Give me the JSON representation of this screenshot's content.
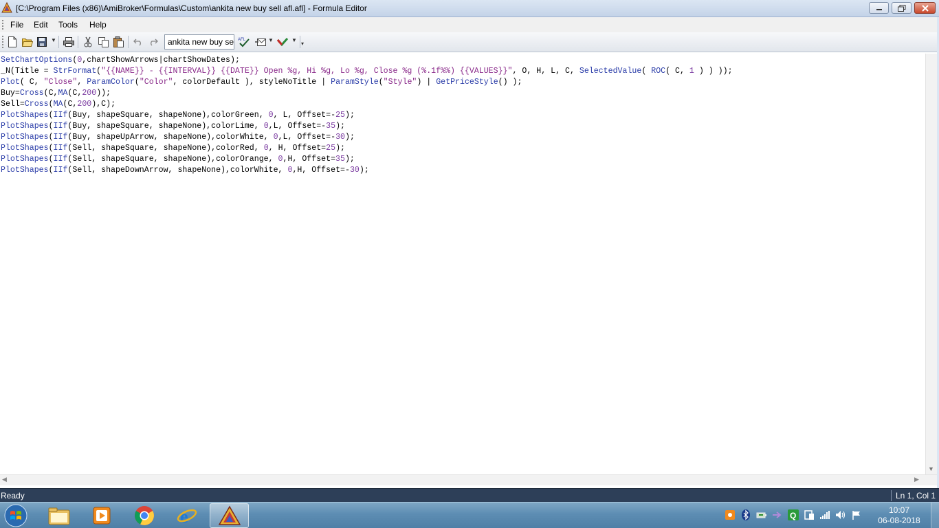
{
  "window": {
    "title": "[C:\\Program Files (x86)\\AmiBroker\\Formulas\\Custom\\ankita new buy sell afl.afl] - Formula Editor"
  },
  "menu": [
    "File",
    "Edit",
    "Tools",
    "Help"
  ],
  "toolbar": {
    "formula_name": "ankita new buy se"
  },
  "code_lines": [
    [
      {
        "t": "SetChartOptions",
        "c": "fn"
      },
      {
        "t": "(",
        "c": "plain"
      },
      {
        "t": "0",
        "c": "num"
      },
      {
        "t": ",chartShowArrows|chartShowDates);",
        "c": "plain"
      }
    ],
    [
      {
        "t": "_N(Title = ",
        "c": "plain"
      },
      {
        "t": "StrFormat",
        "c": "fn"
      },
      {
        "t": "(",
        "c": "plain"
      },
      {
        "t": "\"{{NAME}} - {{INTERVAL}} {{DATE}} Open %g, Hi %g, Lo %g, Close %g (%.1f%%) {{VALUES}}\"",
        "c": "str"
      },
      {
        "t": ", O, H, L, C, ",
        "c": "plain"
      },
      {
        "t": "SelectedValue",
        "c": "fn"
      },
      {
        "t": "( ",
        "c": "plain"
      },
      {
        "t": "ROC",
        "c": "fn"
      },
      {
        "t": "( C, ",
        "c": "plain"
      },
      {
        "t": "1",
        "c": "num"
      },
      {
        "t": " ) ) ));",
        "c": "plain"
      }
    ],
    [
      {
        "t": "Plot",
        "c": "fn"
      },
      {
        "t": "( C, ",
        "c": "plain"
      },
      {
        "t": "\"Close\"",
        "c": "str"
      },
      {
        "t": ", ",
        "c": "plain"
      },
      {
        "t": "ParamColor",
        "c": "fn"
      },
      {
        "t": "(",
        "c": "plain"
      },
      {
        "t": "\"Color\"",
        "c": "str"
      },
      {
        "t": ", colorDefault ), styleNoTitle | ",
        "c": "plain"
      },
      {
        "t": "ParamStyle",
        "c": "fn"
      },
      {
        "t": "(",
        "c": "plain"
      },
      {
        "t": "\"Style\"",
        "c": "str"
      },
      {
        "t": ") | ",
        "c": "plain"
      },
      {
        "t": "GetPriceStyle",
        "c": "fn"
      },
      {
        "t": "() );",
        "c": "plain"
      }
    ],
    [
      {
        "t": "Buy=",
        "c": "plain"
      },
      {
        "t": "Cross",
        "c": "fn"
      },
      {
        "t": "(C,",
        "c": "plain"
      },
      {
        "t": "MA",
        "c": "fn"
      },
      {
        "t": "(C,",
        "c": "plain"
      },
      {
        "t": "200",
        "c": "num"
      },
      {
        "t": "));",
        "c": "plain"
      }
    ],
    [
      {
        "t": "Sell=",
        "c": "plain"
      },
      {
        "t": "Cross",
        "c": "fn"
      },
      {
        "t": "(",
        "c": "plain"
      },
      {
        "t": "MA",
        "c": "fn"
      },
      {
        "t": "(C,",
        "c": "plain"
      },
      {
        "t": "200",
        "c": "num"
      },
      {
        "t": "),C);",
        "c": "plain"
      }
    ],
    [
      {
        "t": "PlotShapes",
        "c": "fn"
      },
      {
        "t": "(",
        "c": "plain"
      },
      {
        "t": "IIf",
        "c": "fn"
      },
      {
        "t": "(Buy, shapeSquare, shapeNone),colorGreen, ",
        "c": "plain"
      },
      {
        "t": "0",
        "c": "num"
      },
      {
        "t": ", L, Offset=-",
        "c": "plain"
      },
      {
        "t": "25",
        "c": "num"
      },
      {
        "t": ");",
        "c": "plain"
      }
    ],
    [
      {
        "t": "PlotShapes",
        "c": "fn"
      },
      {
        "t": "(",
        "c": "plain"
      },
      {
        "t": "IIf",
        "c": "fn"
      },
      {
        "t": "(Buy, shapeSquare, shapeNone),colorLime, ",
        "c": "plain"
      },
      {
        "t": "0",
        "c": "num"
      },
      {
        "t": ",L, Offset=-",
        "c": "plain"
      },
      {
        "t": "35",
        "c": "num"
      },
      {
        "t": ");",
        "c": "plain"
      }
    ],
    [
      {
        "t": "PlotShapes",
        "c": "fn"
      },
      {
        "t": "(",
        "c": "plain"
      },
      {
        "t": "IIf",
        "c": "fn"
      },
      {
        "t": "(Buy, shapeUpArrow, shapeNone),colorWhite, ",
        "c": "plain"
      },
      {
        "t": "0",
        "c": "num"
      },
      {
        "t": ",L, Offset=-",
        "c": "plain"
      },
      {
        "t": "30",
        "c": "num"
      },
      {
        "t": ");",
        "c": "plain"
      }
    ],
    [
      {
        "t": "PlotShapes",
        "c": "fn"
      },
      {
        "t": "(",
        "c": "plain"
      },
      {
        "t": "IIf",
        "c": "fn"
      },
      {
        "t": "(Sell, shapeSquare, shapeNone),colorRed, ",
        "c": "plain"
      },
      {
        "t": "0",
        "c": "num"
      },
      {
        "t": ", H, Offset=",
        "c": "plain"
      },
      {
        "t": "25",
        "c": "num"
      },
      {
        "t": ");",
        "c": "plain"
      }
    ],
    [
      {
        "t": "PlotShapes",
        "c": "fn"
      },
      {
        "t": "(",
        "c": "plain"
      },
      {
        "t": "IIf",
        "c": "fn"
      },
      {
        "t": "(Sell, shapeSquare, shapeNone),colorOrange, ",
        "c": "plain"
      },
      {
        "t": "0",
        "c": "num"
      },
      {
        "t": ",H, Offset=",
        "c": "plain"
      },
      {
        "t": "35",
        "c": "num"
      },
      {
        "t": ");",
        "c": "plain"
      }
    ],
    [
      {
        "t": "PlotShapes",
        "c": "fn"
      },
      {
        "t": "(",
        "c": "plain"
      },
      {
        "t": "IIf",
        "c": "fn"
      },
      {
        "t": "(Sell, shapeDownArrow, shapeNone),colorWhite, ",
        "c": "plain"
      },
      {
        "t": "0",
        "c": "num"
      },
      {
        "t": ",H, Offset=-",
        "c": "plain"
      },
      {
        "t": "30",
        "c": "num"
      },
      {
        "t": ");",
        "c": "plain"
      }
    ]
  ],
  "status": {
    "left": "Ready",
    "right": "Ln 1, Col 1"
  },
  "taskbar": {
    "apps": [
      "windows-explorer",
      "media-player",
      "chrome",
      "internet-explorer",
      "amibroker"
    ],
    "active_app": "amibroker"
  },
  "clock": {
    "time": "10:07",
    "date": "06-08-2018"
  },
  "colors": {
    "keyword": "#2a3ca8",
    "string": "#8a2a8a",
    "number": "#7a3aa0",
    "statusbar": "#2d3f58",
    "taskbar": "#5d8db3"
  }
}
